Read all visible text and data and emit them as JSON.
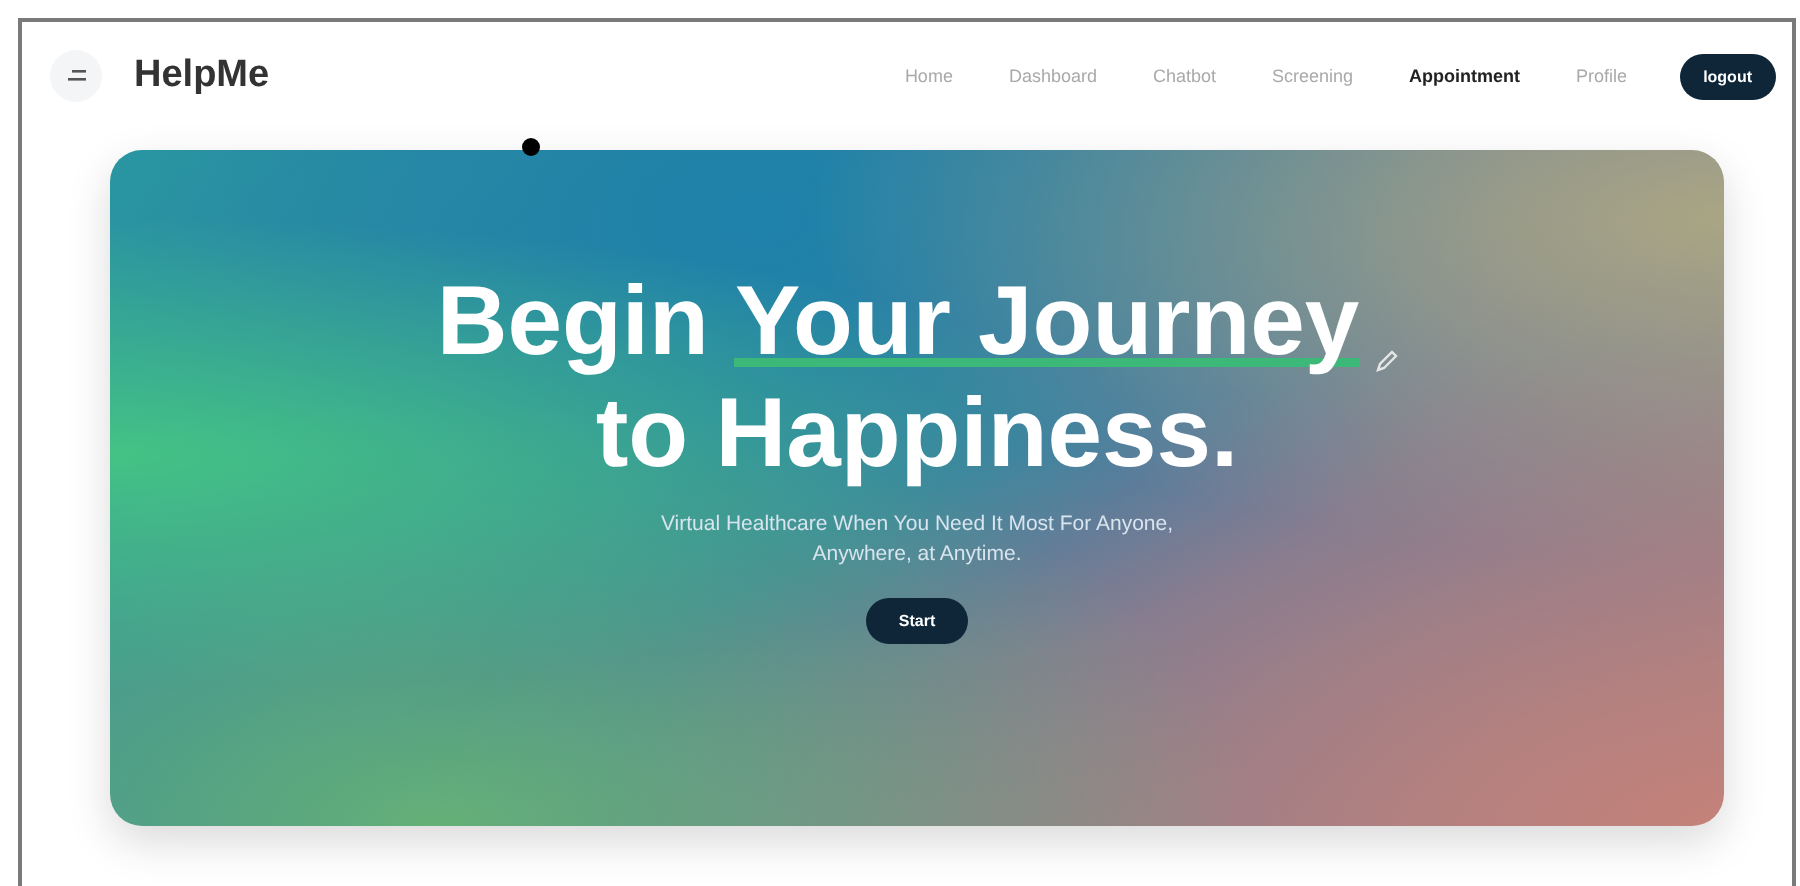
{
  "brand": {
    "name": "HelpMe"
  },
  "nav": [
    {
      "label": "Home",
      "selected": false
    },
    {
      "label": "Dashboard",
      "selected": false
    },
    {
      "label": "Chatbot",
      "selected": false
    },
    {
      "label": "Screening",
      "selected": false
    },
    {
      "label": "Appointment",
      "selected": true
    },
    {
      "label": "Profile",
      "selected": false
    }
  ],
  "logout_button": "logout",
  "hero": {
    "title_lines": [
      [
        {
          "text": "Begin",
          "highlight": false
        },
        {
          "text": "Your Journey",
          "highlight": true
        }
      ],
      [
        {
          "text": "to Happiness.",
          "highlight": false
        }
      ]
    ],
    "subtitle": "Virtual Healthcare When You Need It Most For Anyone, Anywhere, at Anytime.",
    "start_button": "Start"
  }
}
